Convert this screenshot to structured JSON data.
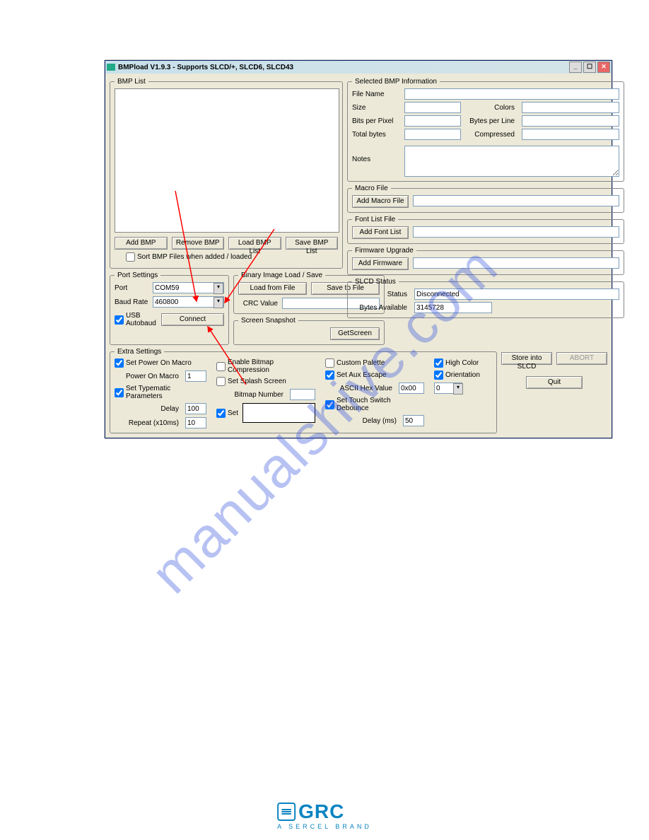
{
  "window": {
    "title": "BMPload V1.9.3 - Supports SLCD/+, SLCD6, SLCD43"
  },
  "bmp_list": {
    "legend": "BMP List",
    "add": "Add BMP",
    "remove": "Remove BMP",
    "load": "Load BMP List",
    "save": "Save BMP List",
    "sort_cb": "Sort BMP Files when added / loaded"
  },
  "port_settings": {
    "legend": "Port Settings",
    "port_lbl": "Port",
    "port_value": "COM59",
    "baud_lbl": "Baud Rate",
    "baud_value": "460800",
    "usb_cb": "USB Autobaud",
    "connect": "Connect"
  },
  "binary": {
    "legend": "Binary Image Load / Save",
    "load": "Load from File",
    "save": "Save to File",
    "crc_lbl": "CRC Value"
  },
  "snapshot": {
    "legend": "Screen Snapshot",
    "get": "GetScreen"
  },
  "extra": {
    "legend": "Extra Settings",
    "power_cb": "Set Power On Macro",
    "power_lbl": "Power On Macro",
    "power_val": "1",
    "typematic_cb": "Set Typematic Parameters",
    "delay_lbl": "Delay",
    "delay_val": "100",
    "repeat_lbl": "Repeat (x10ms)",
    "repeat_val": "10",
    "enable_compression_cb": "Enable Bitmap Compression",
    "splash_cb": "Set Splash Screen",
    "bitmap_num_lbl": "Bitmap Number",
    "set_cb": "Set",
    "custom_palette_cb": "Custom Palette",
    "aux_escape_cb": "Set Aux Escape",
    "ascii_lbl": "ASCII Hex Value",
    "ascii_val": "0x00",
    "touch_cb": "Set Touch Switch Debounce",
    "touch_delay_lbl": "Delay (ms)",
    "touch_delay_val": "50",
    "high_color_cb": "High Color",
    "orientation_cb": "Orientation",
    "orientation_val": "0"
  },
  "bmp_info": {
    "legend": "Selected BMP Information",
    "file_name": "File Name",
    "size": "Size",
    "colors": "Colors",
    "bpp": "Bits per Pixel",
    "bpl": "Bytes per Line",
    "total": "Total bytes",
    "compressed": "Compressed",
    "notes": "Notes"
  },
  "macro": {
    "legend": "Macro File",
    "btn": "Add Macro File"
  },
  "fontlist": {
    "legend": "Font List File",
    "btn": "Add Font List"
  },
  "firmware": {
    "legend": "Firmware Upgrade",
    "btn": "Add Firmware"
  },
  "status": {
    "legend": "SLCD Status",
    "status_lbl": "Status",
    "status_val": "Disconnected",
    "bytes_lbl": "Bytes Available",
    "bytes_val": "3145728"
  },
  "store": "Store into SLCD",
  "abort": "ABORT",
  "quit": "Quit",
  "watermark": "manualshive.com",
  "logo": {
    "brand": "GRC",
    "sub": "A SERCEL BRAND"
  }
}
